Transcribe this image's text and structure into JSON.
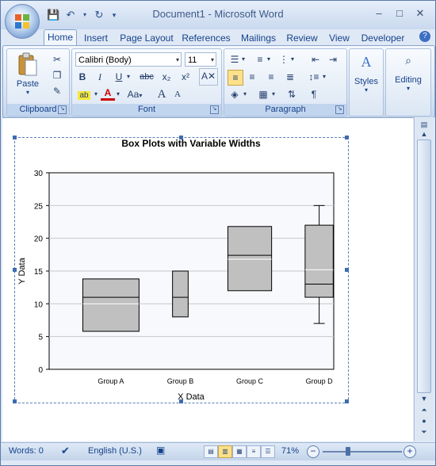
{
  "window": {
    "title": "Document1 - Microsoft Word",
    "quick_access": [
      "save-icon",
      "undo-icon",
      "redo-icon",
      "customize-icon"
    ],
    "controls": {
      "minimize": "–",
      "maximize": "□",
      "close": "✕"
    }
  },
  "tabs": [
    "Home",
    "Insert",
    "Page Layout",
    "References",
    "Mailings",
    "Review",
    "View",
    "Developer"
  ],
  "active_tab": "Home",
  "ribbon": {
    "clipboard": {
      "label": "Clipboard",
      "paste": "Paste"
    },
    "font": {
      "label": "Font",
      "font_name": "Calibri (Body)",
      "font_size": "11",
      "bold": "B",
      "italic": "I",
      "underline": "U",
      "strike": "abc",
      "sub": "x₂",
      "sup": "x²",
      "grow": "A",
      "shrink": "A",
      "case": "Aa"
    },
    "paragraph": {
      "label": "Paragraph"
    },
    "styles": {
      "label": "Styles"
    },
    "editing": {
      "label": "Editing"
    }
  },
  "chart_data": {
    "type": "boxplot",
    "title": "Box Plots with Variable Widths",
    "xlabel": "X Data",
    "ylabel": "Y Data",
    "ylim": [
      0,
      30
    ],
    "yticks": [
      0,
      5,
      10,
      15,
      20,
      25,
      30
    ],
    "categories": [
      "Group A",
      "Group B",
      "Group C",
      "Group D"
    ],
    "boxes": [
      {
        "group": "Group A",
        "q1": 5.8,
        "median": 11,
        "mean": 10,
        "q3": 13.8,
        "min": null,
        "max": null,
        "width": 0.9
      },
      {
        "group": "Group B",
        "q1": 8,
        "median": 11,
        "mean": 11,
        "q3": 15,
        "min": null,
        "max": null,
        "width": 0.25
      },
      {
        "group": "Group C",
        "q1": 12,
        "median": 17.4,
        "mean": 16.8,
        "q3": 21.8,
        "min": null,
        "max": null,
        "width": 0.7
      },
      {
        "group": "Group D",
        "q1": 11,
        "median": 13,
        "mean": 15.2,
        "q3": 22,
        "min": 7,
        "max": 25,
        "width": 0.45
      }
    ],
    "grid": true,
    "box_color": "#c0c0c0"
  },
  "status": {
    "words": "Words: 0",
    "language": "English (U.S.)",
    "zoom": "71%",
    "zoom_fraction": 0.71
  }
}
